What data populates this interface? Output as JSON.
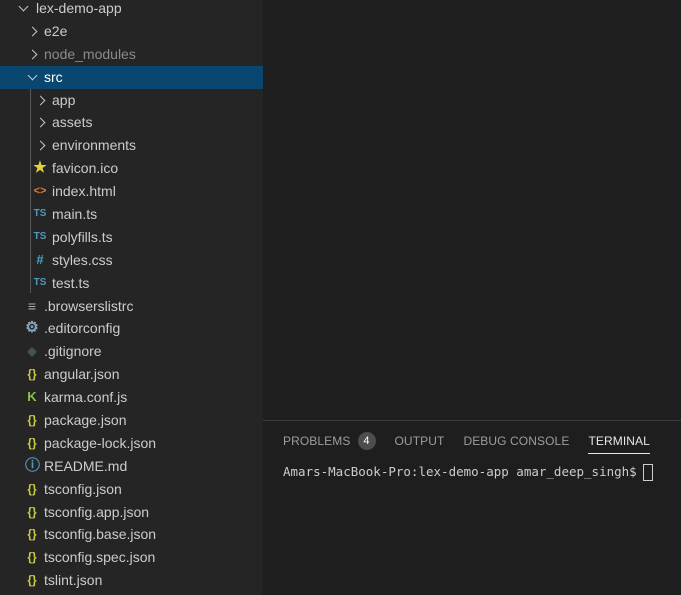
{
  "explorer": {
    "items": [
      {
        "label": "lex-demo-app",
        "kind": "folder",
        "open": true,
        "depth": 0
      },
      {
        "label": "e2e",
        "kind": "folder",
        "open": false,
        "depth": 1
      },
      {
        "label": "node_modules",
        "kind": "folder",
        "open": false,
        "depth": 1,
        "dim": true
      },
      {
        "label": "src",
        "kind": "folder",
        "open": true,
        "depth": 1,
        "selected": true
      },
      {
        "label": "app",
        "kind": "folder",
        "open": false,
        "depth": 2
      },
      {
        "label": "assets",
        "kind": "folder",
        "open": false,
        "depth": 2
      },
      {
        "label": "environments",
        "kind": "folder",
        "open": false,
        "depth": 2
      },
      {
        "label": "favicon.ico",
        "kind": "file",
        "depth": 2,
        "icon": "star-icon"
      },
      {
        "label": "index.html",
        "kind": "file",
        "depth": 2,
        "icon": "html-icon"
      },
      {
        "label": "main.ts",
        "kind": "file",
        "depth": 2,
        "icon": "typescript-icon"
      },
      {
        "label": "polyfills.ts",
        "kind": "file",
        "depth": 2,
        "icon": "typescript-icon"
      },
      {
        "label": "styles.css",
        "kind": "file",
        "depth": 2,
        "icon": "css-icon"
      },
      {
        "label": "test.ts",
        "kind": "file",
        "depth": 2,
        "icon": "typescript-icon"
      },
      {
        "label": ".browserslistrc",
        "kind": "file",
        "depth": 1,
        "icon": "lines-icon"
      },
      {
        "label": ".editorconfig",
        "kind": "file",
        "depth": 1,
        "icon": "gear-icon"
      },
      {
        "label": ".gitignore",
        "kind": "file",
        "depth": 1,
        "icon": "git-icon"
      },
      {
        "label": "angular.json",
        "kind": "file",
        "depth": 1,
        "icon": "json-icon"
      },
      {
        "label": "karma.conf.js",
        "kind": "file",
        "depth": 1,
        "icon": "karma-icon"
      },
      {
        "label": "package.json",
        "kind": "file",
        "depth": 1,
        "icon": "json-icon"
      },
      {
        "label": "package-lock.json",
        "kind": "file",
        "depth": 1,
        "icon": "json-icon"
      },
      {
        "label": "README.md",
        "kind": "file",
        "depth": 1,
        "icon": "info-icon"
      },
      {
        "label": "tsconfig.json",
        "kind": "file",
        "depth": 1,
        "icon": "json-icon"
      },
      {
        "label": "tsconfig.app.json",
        "kind": "file",
        "depth": 1,
        "icon": "json-icon"
      },
      {
        "label": "tsconfig.base.json",
        "kind": "file",
        "depth": 1,
        "icon": "json-icon"
      },
      {
        "label": "tsconfig.spec.json",
        "kind": "file",
        "depth": 1,
        "icon": "json-icon"
      },
      {
        "label": "tslint.json",
        "kind": "file",
        "depth": 1,
        "icon": "json-icon"
      }
    ]
  },
  "panel": {
    "tabs": {
      "problems": "PROBLEMS",
      "problems_count": "4",
      "output": "OUTPUT",
      "debug_console": "DEBUG CONSOLE",
      "terminal": "TERMINAL"
    },
    "active_tab": "TERMINAL",
    "terminal_prompt": "Amars-MacBook-Pro:lex-demo-app amar_deep_singh$"
  },
  "colors": {
    "selection": "#094771",
    "sidebar": "#252526",
    "editor": "#1e1e1e"
  }
}
